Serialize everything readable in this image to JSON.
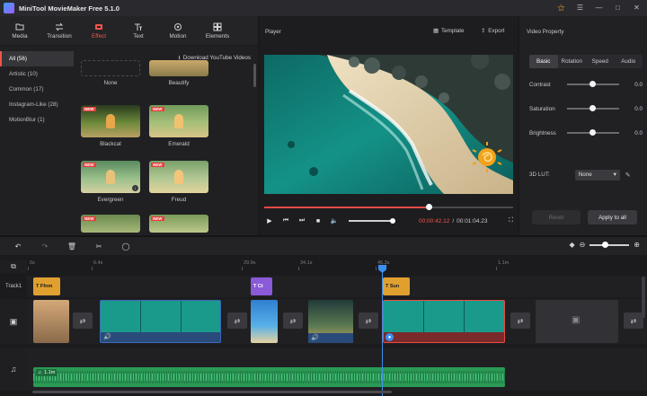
{
  "app": {
    "title": "MiniTool MovieMaker Free 5.1.0"
  },
  "window_controls": [
    "key-icon",
    "menu-icon",
    "minimize-icon",
    "maximize-icon",
    "close-icon"
  ],
  "toolbar": {
    "items": [
      {
        "label": "Media",
        "icon": "folder-icon"
      },
      {
        "label": "Transition",
        "icon": "transition-icon"
      },
      {
        "label": "Effect",
        "icon": "effect-icon",
        "active": true
      },
      {
        "label": "Text",
        "icon": "text-icon"
      },
      {
        "label": "Motion",
        "icon": "motion-icon"
      },
      {
        "label": "Elements",
        "icon": "elements-icon"
      }
    ]
  },
  "effect_panel": {
    "categories": [
      {
        "label": "All (56)",
        "active": true
      },
      {
        "label": "Artistic (10)"
      },
      {
        "label": "Common (17)"
      },
      {
        "label": "Instagram-Like (28)"
      },
      {
        "label": "MotionBlur (1)"
      }
    ],
    "download_label": "Download YouTube Videos",
    "new_badge": "NEW",
    "thumbnails": [
      {
        "label": "None"
      },
      {
        "label": "Beautify"
      },
      {
        "label": "Blackcat"
      },
      {
        "label": "Emerald"
      },
      {
        "label": "Evergreen"
      },
      {
        "label": "Freud"
      }
    ]
  },
  "player": {
    "title": "Player",
    "template_label": "Template",
    "export_label": "Export",
    "progress": 0.66,
    "current_time": "00:00:42.12",
    "separator": "/",
    "total_time": "00:01:04.23"
  },
  "properties": {
    "title": "Video Property",
    "tabs": [
      {
        "label": "Basic",
        "active": true
      },
      {
        "label": "Rotation"
      },
      {
        "label": "Speed"
      },
      {
        "label": "Audio"
      }
    ],
    "sliders": [
      {
        "label": "Contrast",
        "value": "0.0"
      },
      {
        "label": "Saturation",
        "value": "0.0"
      },
      {
        "label": "Brightness",
        "value": "0.0"
      }
    ],
    "lut_label": "3D LUT:",
    "lut_value": "None",
    "reset_label": "Reset",
    "apply_label": "Apply to all"
  },
  "timeline": {
    "ruler": [
      "0s",
      "6.4s",
      "29.9s",
      "34.1s",
      "45.3s",
      "1.1m"
    ],
    "track_label": "Track1",
    "text_clips": [
      {
        "label": "Ffnm"
      },
      {
        "label": "Ct"
      },
      {
        "label": "Sun"
      }
    ],
    "audio_clip": {
      "label": "1.1m"
    }
  },
  "colors": {
    "accent": "#f0554a",
    "playhead": "#3a8ff0",
    "audio": "#2a9a55",
    "text_clip": "#e0a030",
    "title_clip": "#8a5ad8"
  }
}
